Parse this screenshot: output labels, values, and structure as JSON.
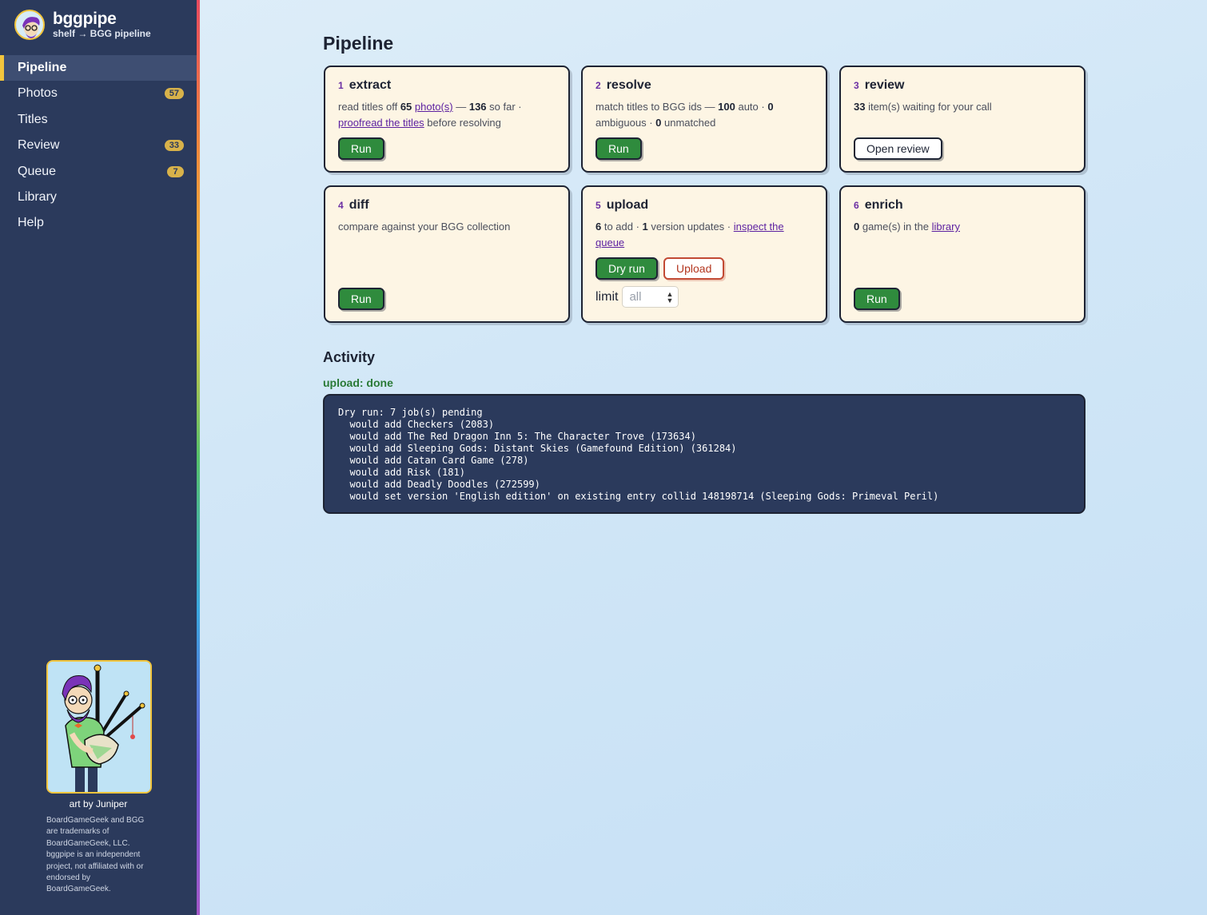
{
  "brand": {
    "name": "bggpipe",
    "subtitle": "shelf → BGG pipeline"
  },
  "nav": [
    {
      "label": "Pipeline",
      "active": true,
      "badge": null
    },
    {
      "label": "Photos",
      "badge": "57"
    },
    {
      "label": "Titles",
      "badge": null
    },
    {
      "label": "Review",
      "badge": "33"
    },
    {
      "label": "Queue",
      "badge": "7"
    },
    {
      "label": "Library",
      "badge": null
    },
    {
      "label": "Help",
      "badge": null
    }
  ],
  "sidebar_footer": {
    "art_credit": "art by Juniper",
    "legal": "BoardGameGeek and BGG are trademarks of BoardGameGeek, LLC. bggpipe is an independent project, not affiliated with or endorsed by BoardGameGeek."
  },
  "page_title": "Pipeline",
  "steps": {
    "extract": {
      "num": "1",
      "title": "extract",
      "t1": "read titles off ",
      "photos_count": "65",
      "photos_link": "photo(s)",
      "t2": " — ",
      "sofar_count": "136",
      "t3": " so far · ",
      "proofread_link": "proofread the titles",
      "t4": " before resolving",
      "button": "Run"
    },
    "resolve": {
      "num": "2",
      "title": "resolve",
      "t1": "match titles to BGG ids — ",
      "auto_count": "100",
      "t2": " auto · ",
      "ambiguous_count": "0",
      "t3": " ambiguous · ",
      "unmatched_count": "0",
      "t4": " unmatched",
      "button": "Run"
    },
    "review": {
      "num": "3",
      "title": "review",
      "waiting_count": "33",
      "t1": " item(s) waiting for your call",
      "button": "Open review"
    },
    "diff": {
      "num": "4",
      "title": "diff",
      "desc": "compare against your BGG collection",
      "button": "Run"
    },
    "upload": {
      "num": "5",
      "title": "upload",
      "add_count": "6",
      "t1": " to add · ",
      "version_count": "1",
      "t2": " version updates · ",
      "queue_link": "inspect the queue",
      "dry_run_button": "Dry run",
      "upload_button": "Upload",
      "limit_label": "limit",
      "limit_placeholder": "all"
    },
    "enrich": {
      "num": "6",
      "title": "enrich",
      "games_count": "0",
      "t1": " game(s) in the ",
      "library_link": "library",
      "button": "Run"
    }
  },
  "activity": {
    "title": "Activity",
    "status": "upload: done",
    "log": [
      "Dry run: 7 job(s) pending",
      "  would add Checkers (2083)",
      "  would add The Red Dragon Inn 5: The Character Trove (173634)",
      "  would add Sleeping Gods: Distant Skies (Gamefound Edition) (361284)",
      "  would add Catan Card Game (278)",
      "  would add Risk (181)",
      "  would add Deadly Doodles (272599)",
      "  would set version 'English edition' on existing entry collid 148198714 (Sleeping Gods: Primeval Peril)"
    ]
  },
  "colors": {
    "sidebar": "#2b3a5c",
    "accent_yellow": "#f2c53d",
    "run_green": "#2f8b3d",
    "card_bg": "#fdf5e4",
    "link_purple": "#5b1fa0",
    "status_green": "#2a7a36",
    "danger": "#b3361f"
  }
}
